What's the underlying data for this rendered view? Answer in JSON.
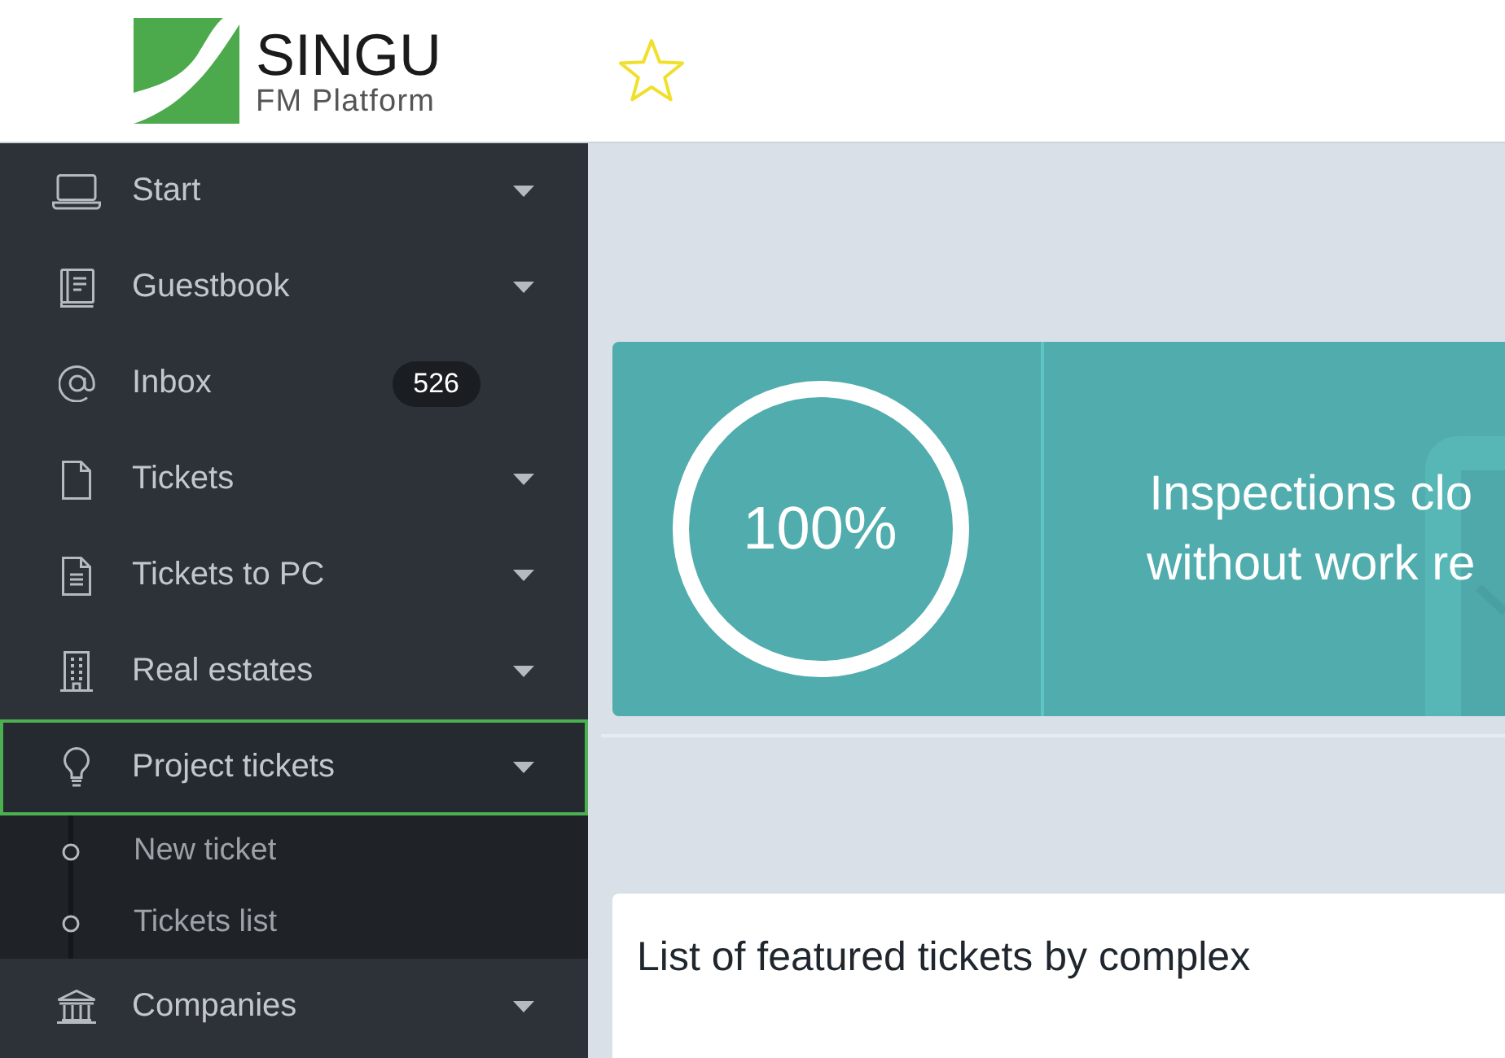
{
  "header": {
    "logo": {
      "name": "SINGU",
      "tagline": "FM Platform"
    },
    "favorite": {
      "on": false
    }
  },
  "sidebar": {
    "items": [
      {
        "label": "Start",
        "kind": "dropdown",
        "selected": false
      },
      {
        "label": "Guestbook",
        "kind": "dropdown",
        "selected": false
      },
      {
        "label": "Inbox",
        "kind": "counter",
        "badge": "526",
        "selected": false
      },
      {
        "label": "Tickets",
        "kind": "dropdown",
        "selected": false
      },
      {
        "label": "Tickets to PC",
        "kind": "dropdown",
        "selected": false
      },
      {
        "label": "Real estates",
        "kind": "dropdown",
        "selected": false
      },
      {
        "label": "Project tickets",
        "kind": "dropdown",
        "selected": true,
        "expanded": true,
        "children": [
          {
            "label": "New ticket",
            "selected": false
          },
          {
            "label": "Tickets list",
            "selected": false
          }
        ]
      },
      {
        "label": "Companies",
        "kind": "dropdown",
        "selected": false
      }
    ]
  },
  "summary_card": {
    "level": 1,
    "reading": "100%",
    "caption_lines": [
      "Inspections clo",
      "without work re"
    ]
  },
  "featured_card": {
    "title": "List of featured tickets by complex"
  }
}
